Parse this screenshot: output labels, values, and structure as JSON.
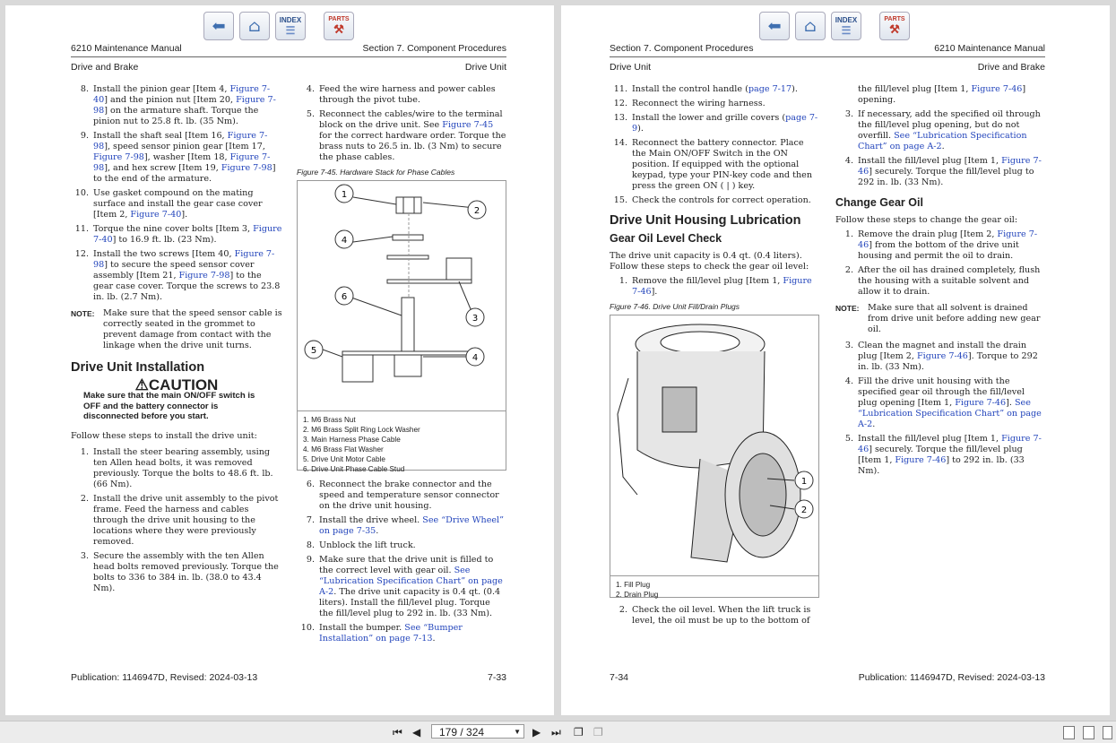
{
  "nav": {
    "index_label": "INDEX",
    "parts_label": "PARTS"
  },
  "left_page": {
    "header_left": "6210 Maintenance Manual",
    "header_right": "Section 7.  Component Procedures",
    "subheader_left": "Drive and Brake",
    "subheader_right": "Drive Unit",
    "footer_left": "Publication: 1146947D, Revised: 2024-03-13",
    "footer_right": "7-33",
    "col1_steps": [
      {
        "n": "8.",
        "parts": [
          [
            "t",
            "Install the pinion gear [Item 4, "
          ],
          [
            "l",
            "Figure 7-40"
          ],
          [
            "t",
            "] and the pinion nut [Item 20, "
          ],
          [
            "l",
            "Figure 7-98"
          ],
          [
            "t",
            "] on the armature shaft. Torque the pinion nut to 25.8 ft. lb. (35 Nm)."
          ]
        ]
      },
      {
        "n": "9.",
        "parts": [
          [
            "t",
            "Install the shaft seal [Item 16, "
          ],
          [
            "l",
            "Figure 7-98"
          ],
          [
            "t",
            "], speed sensor pinion gear [Item 17, "
          ],
          [
            "l",
            "Figure 7-98"
          ],
          [
            "t",
            "], washer [Item 18, "
          ],
          [
            "l",
            "Figure 7-98"
          ],
          [
            "t",
            "], and hex screw [Item 19, "
          ],
          [
            "l",
            "Figure 7-98"
          ],
          [
            "t",
            "] to the end of the armature."
          ]
        ]
      },
      {
        "n": "10.",
        "parts": [
          [
            "t",
            "Use gasket compound on the mating surface and install the gear case cover [Item 2, "
          ],
          [
            "l",
            "Figure 7-40"
          ],
          [
            "t",
            "]."
          ]
        ]
      },
      {
        "n": "11.",
        "parts": [
          [
            "t",
            "Torque the nine cover bolts [Item 3, "
          ],
          [
            "l",
            "Figure 7-40"
          ],
          [
            "t",
            "] to 16.9 ft. lb. (23 Nm)."
          ]
        ]
      },
      {
        "n": "12.",
        "parts": [
          [
            "t",
            "Install the two screws [Item 40, "
          ],
          [
            "l",
            "Figure 7-98"
          ],
          [
            "t",
            "] to secure the speed sensor cover assembly [Item 21, "
          ],
          [
            "l",
            "Figure 7-98"
          ],
          [
            "t",
            "] to the gear case cover. Torque the screws to 23.8 in. lb. (2.7 Nm)."
          ]
        ]
      }
    ],
    "note_label": "NOTE:",
    "note_text": "Make sure that the speed sensor cable is correctly seated in the grommet to prevent damage from contact with the linkage when the drive unit turns.",
    "install_heading": "Drive Unit Installation",
    "caution_title": "CAUTION",
    "caution_text": "Make sure that the main ON/OFF switch is OFF and the battery connector is disconnected before you start.",
    "install_intro": "Follow these steps to install the drive unit:",
    "install_steps": [
      {
        "n": "1.",
        "parts": [
          [
            "t",
            "Install the steer bearing assembly, using ten Allen head bolts, it was removed previously. Torque the bolts to 48.6 ft. lb. (66 Nm)."
          ]
        ]
      },
      {
        "n": "2.",
        "parts": [
          [
            "t",
            "Install the drive unit assembly to the pivot frame. Feed the harness and cables through the drive unit housing to the locations where they were previously removed."
          ]
        ]
      },
      {
        "n": "3.",
        "parts": [
          [
            "t",
            "Secure the assembly with the ten Allen head bolts removed previously. Torque the bolts to 336 to 384 in. lb. (38.0 to 43.4 Nm)."
          ]
        ]
      }
    ],
    "col2_steps_a": [
      {
        "n": "4.",
        "parts": [
          [
            "t",
            "Feed the wire harness and power cables through the pivot tube."
          ]
        ]
      },
      {
        "n": "5.",
        "parts": [
          [
            "t",
            "Reconnect the cables/wire to the terminal block on the drive unit. See "
          ],
          [
            "l",
            "Figure 7-45"
          ],
          [
            "t",
            " for the correct hardware order. Torque the brass nuts to 26.5 in. lb. (3 Nm) to secure the phase cables."
          ]
        ]
      }
    ],
    "figure_caption": "Figure 7-45.    Hardware Stack for Phase Cables",
    "figure_callouts": [
      "1",
      "2",
      "4",
      "6",
      "3",
      "5",
      "4"
    ],
    "figure_legend": [
      "1. M6 Brass Nut",
      "2. M6 Brass Split Ring Lock Washer",
      "3. Main Harness Phase Cable",
      "4. M6 Brass Flat Washer",
      "5. Drive Unit Motor Cable",
      "6. Drive Unit Phase Cable Stud"
    ],
    "col2_steps_b": [
      {
        "n": "6.",
        "parts": [
          [
            "t",
            "Reconnect the brake connector and the speed and temperature sensor connector on the drive unit housing."
          ]
        ]
      },
      {
        "n": "7.",
        "parts": [
          [
            "t",
            "Install the drive wheel. "
          ],
          [
            "l",
            "See “Drive Wheel” on page 7-35"
          ],
          [
            "t",
            "."
          ]
        ]
      },
      {
        "n": "8.",
        "parts": [
          [
            "t",
            "Unblock the lift truck."
          ]
        ]
      },
      {
        "n": "9.",
        "parts": [
          [
            "t",
            "Make sure that the drive unit is filled to the correct level with gear oil. "
          ],
          [
            "l",
            "See “Lubrication Specification Chart” on page A-2"
          ],
          [
            "t",
            ". The drive unit capacity is 0.4 qt. (0.4 liters). Install the fill/level plug. Torque the fill/level plug to 292 in. lb. (33 Nm)."
          ]
        ]
      },
      {
        "n": "10.",
        "parts": [
          [
            "t",
            "Install the bumper. "
          ],
          [
            "l",
            "See “Bumper Installation” on page 7-13"
          ],
          [
            "t",
            "."
          ]
        ]
      }
    ]
  },
  "right_page": {
    "header_left": "Section 7.  Component Procedures",
    "header_right": "6210 Maintenance Manual",
    "subheader_left": "Drive Unit",
    "subheader_right": "Drive and Brake",
    "footer_left": "7-34",
    "footer_right": "Publication: 1146947D, Revised: 2024-03-13",
    "col1_steps": [
      {
        "n": "11.",
        "parts": [
          [
            "t",
            "Install the control handle ("
          ],
          [
            "l",
            "page 7-17"
          ],
          [
            "t",
            ")."
          ]
        ]
      },
      {
        "n": "12.",
        "parts": [
          [
            "t",
            "Reconnect the wiring harness."
          ]
        ]
      },
      {
        "n": "13.",
        "parts": [
          [
            "t",
            "Install the lower and grille covers ("
          ],
          [
            "l",
            "page 7-9"
          ],
          [
            "t",
            ")."
          ]
        ]
      },
      {
        "n": "14.",
        "parts": [
          [
            "t",
            "Reconnect the battery connector. Place the Main ON/OFF Switch in the ON position. If equipped with the optional keypad, type your PIN-key code and then press the green ON ( | ) key."
          ]
        ]
      },
      {
        "n": "15.",
        "parts": [
          [
            "t",
            "Check the controls for correct operation."
          ]
        ]
      }
    ],
    "lube_heading": "Drive Unit Housing Lubrication",
    "level_heading": "Gear Oil Level Check",
    "level_intro": "The drive unit capacity is 0.4 qt. (0.4 liters). Follow these steps to check the gear oil level:",
    "level_steps": [
      {
        "n": "1.",
        "parts": [
          [
            "t",
            "Remove the fill/level plug [Item 1, "
          ],
          [
            "l",
            "Figure 7-46"
          ],
          [
            "t",
            "]."
          ]
        ]
      }
    ],
    "figure_caption": "Figure 7-46.    Drive Unit Fill/Drain Plugs",
    "figure_callouts": [
      "1",
      "2"
    ],
    "figure_legend": [
      "1. Fill Plug",
      "2. Drain Plug"
    ],
    "level_steps_b": [
      {
        "n": "2.",
        "parts": [
          [
            "t",
            "Check the oil level. When the lift truck is level, the oil must be up to the bottom of"
          ]
        ]
      }
    ],
    "col2_cont": [
      {
        "n": "",
        "parts": [
          [
            "t",
            "the fill/level plug [Item 1, "
          ],
          [
            "l",
            "Figure 7-46"
          ],
          [
            "t",
            "] opening."
          ]
        ]
      },
      {
        "n": "3.",
        "parts": [
          [
            "t",
            "If necessary, add the specified oil through the fill/level plug opening, but do not overfill. "
          ],
          [
            "l",
            "See “Lubrication Specification Chart” on page A-2"
          ],
          [
            "t",
            "."
          ]
        ]
      },
      {
        "n": "4.",
        "parts": [
          [
            "t",
            "Install the fill/level plug [Item 1, "
          ],
          [
            "l",
            "Figure 7-46"
          ],
          [
            "t",
            "] securely. Torque the fill/level plug to 292 in. lb. (33 Nm)."
          ]
        ]
      }
    ],
    "change_heading": "Change Gear Oil",
    "change_intro": "Follow these steps to change the gear oil:",
    "change_steps_a": [
      {
        "n": "1.",
        "parts": [
          [
            "t",
            "Remove the drain plug [Item 2, "
          ],
          [
            "l",
            "Figure 7-46"
          ],
          [
            "t",
            "] from the bottom of the drive unit housing and permit the oil to drain."
          ]
        ]
      },
      {
        "n": "2.",
        "parts": [
          [
            "t",
            "After the oil has drained completely, flush the housing with a suitable solvent and allow it to drain."
          ]
        ]
      }
    ],
    "note_label": "NOTE:",
    "note_text": "Make sure that all solvent is drained from drive unit before adding new gear oil.",
    "change_steps_b": [
      {
        "n": "3.",
        "parts": [
          [
            "t",
            "Clean the magnet and install the drain plug [Item 2, "
          ],
          [
            "l",
            "Figure 7-46"
          ],
          [
            "t",
            "]. Torque to 292 in. lb. (33 Nm)."
          ]
        ]
      },
      {
        "n": "4.",
        "parts": [
          [
            "t",
            "Fill the drive unit housing with the specified gear oil through the fill/level plug opening [Item 1, "
          ],
          [
            "l",
            "Figure 7-46"
          ],
          [
            "t",
            "]. "
          ],
          [
            "l",
            "See “Lubrication Specification Chart” on page A-2"
          ],
          [
            "t",
            "."
          ]
        ]
      },
      {
        "n": "5.",
        "parts": [
          [
            "t",
            "Install the fill/level plug [Item 1, "
          ],
          [
            "l",
            "Figure 7-46"
          ],
          [
            "t",
            "] securely. Torque the fill/level plug [Item 1, "
          ],
          [
            "l",
            "Figure 7-46"
          ],
          [
            "t",
            "] to 292 in. lb. (33 Nm)."
          ]
        ]
      }
    ]
  },
  "toolbar": {
    "page_value": "179 / 324"
  }
}
